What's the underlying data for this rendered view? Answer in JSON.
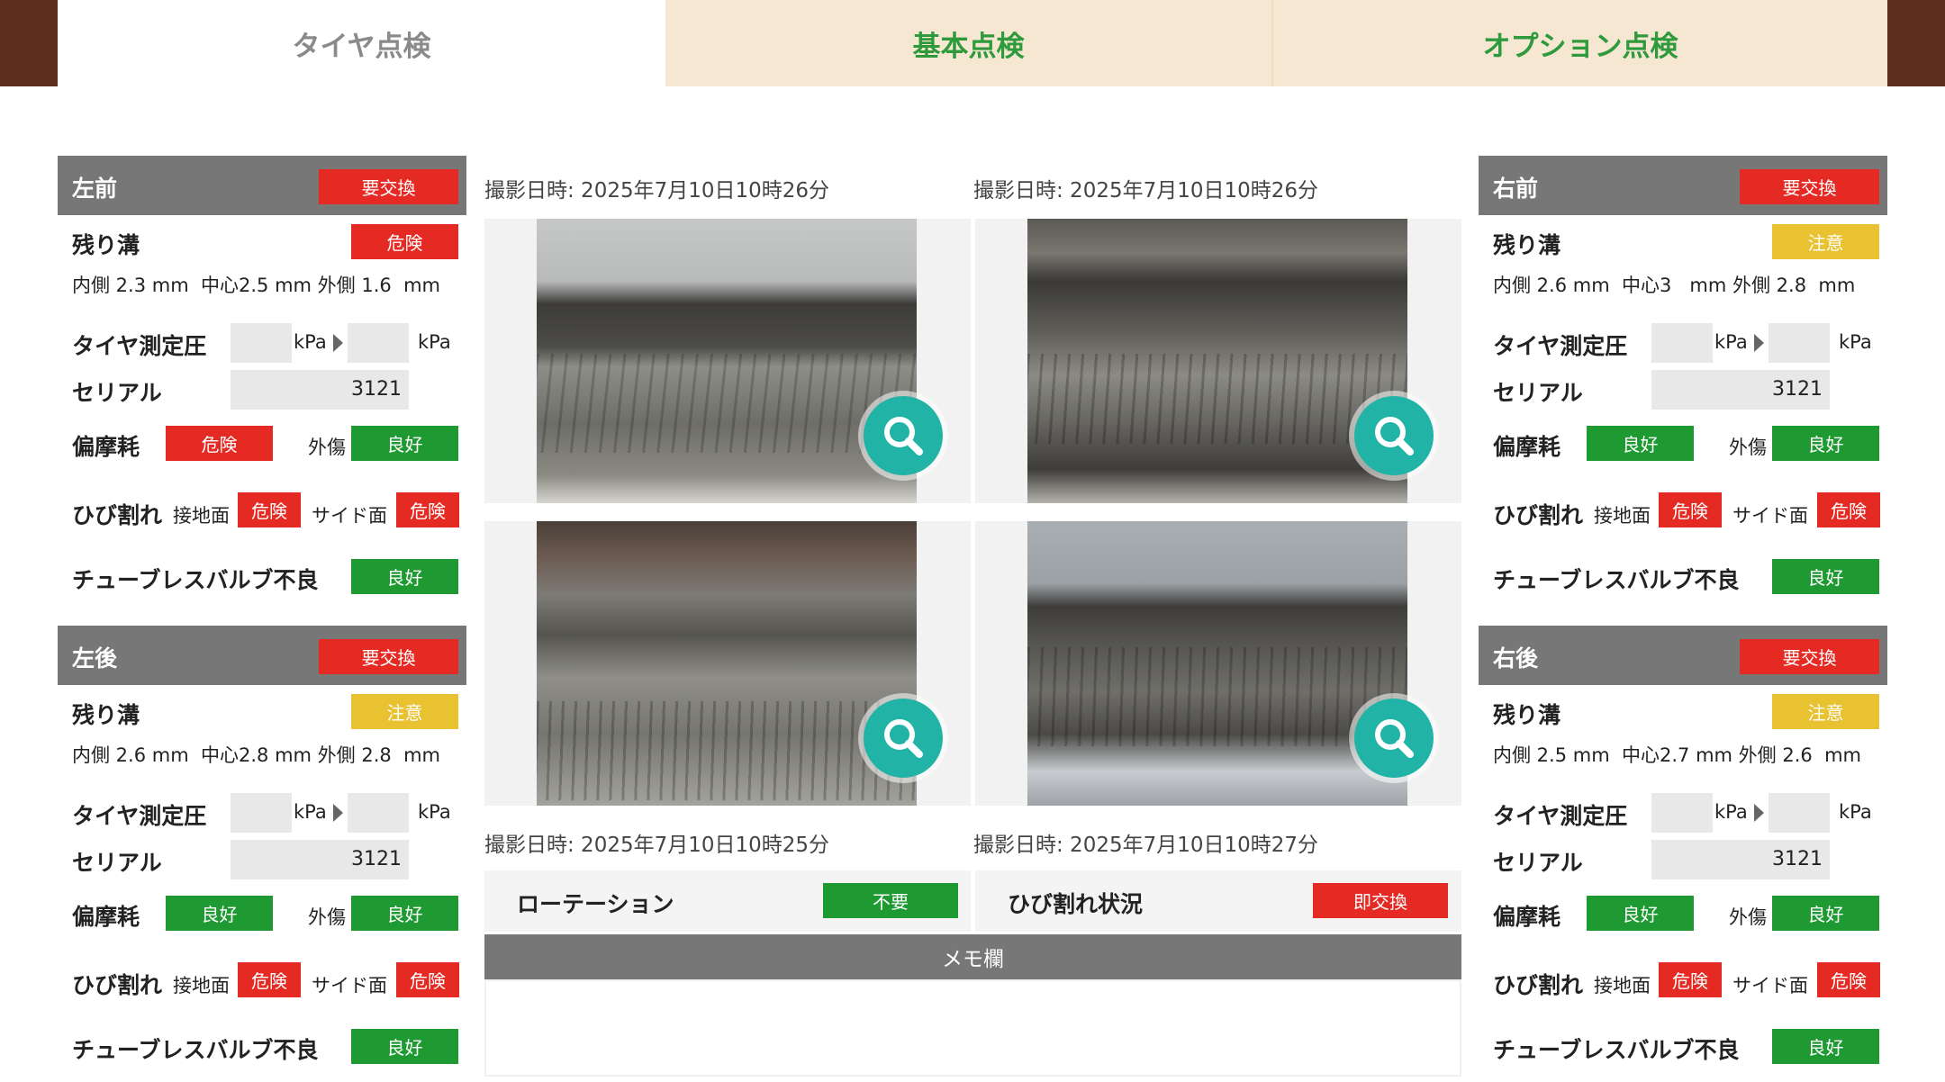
{
  "tabs": [
    "タイヤ点検",
    "基本点検",
    "オプション点検"
  ],
  "tires": [
    {
      "position": "左前",
      "status": "要交換",
      "groove_label": "残り溝",
      "groove_status": "危険",
      "groove_detail": "内側 2.3 mm  中心2.5 mm 外側 1.6  mm",
      "pressure_label": "タイヤ測定圧",
      "unit1": "kPa",
      "unit2": "kPa",
      "serial_label": "セリアル",
      "serial": "3121",
      "uneven_label": "偏摩耗",
      "uneven": "危険",
      "damage_label": "外傷",
      "damage": "良好",
      "crack_label": "ひび割れ",
      "ground_label": "接地面",
      "ground": "危険",
      "side_label": "サイド面",
      "side": "危険",
      "valve_label": "チューブレスバルブ不良",
      "valve": "良好"
    },
    {
      "position": "左後",
      "status": "要交換",
      "groove_label": "残り溝",
      "groove_status": "注意",
      "groove_detail": "内側 2.6 mm  中心2.8 mm 外側 2.8  mm",
      "pressure_label": "タイヤ測定圧",
      "unit1": "kPa",
      "unit2": "kPa",
      "serial_label": "セリアル",
      "serial": "3121",
      "uneven_label": "偏摩耗",
      "uneven": "良好",
      "damage_label": "外傷",
      "damage": "良好",
      "crack_label": "ひび割れ",
      "ground_label": "接地面",
      "ground": "危険",
      "side_label": "サイド面",
      "side": "危険",
      "valve_label": "チューブレスバルブ不良",
      "valve": "良好"
    },
    {
      "position": "右前",
      "status": "要交換",
      "groove_label": "残り溝",
      "groove_status": "注意",
      "groove_detail": "内側 2.6 mm  中心3   mm 外側 2.8  mm",
      "pressure_label": "タイヤ測定圧",
      "unit1": "kPa",
      "unit2": "kPa",
      "serial_label": "セリアル",
      "serial": "3121",
      "uneven_label": "偏摩耗",
      "uneven": "良好",
      "damage_label": "外傷",
      "damage": "良好",
      "crack_label": "ひび割れ",
      "ground_label": "接地面",
      "ground": "危険",
      "side_label": "サイド面",
      "side": "危険",
      "valve_label": "チューブレスバルブ不良",
      "valve": "良好"
    },
    {
      "position": "右後",
      "status": "要交換",
      "groove_label": "残り溝",
      "groove_status": "注意",
      "groove_detail": "内側 2.5 mm  中心2.7 mm 外側 2.6  mm",
      "pressure_label": "タイヤ測定圧",
      "unit1": "kPa",
      "unit2": "kPa",
      "serial_label": "セリアル",
      "serial": "3121",
      "uneven_label": "偏摩耗",
      "uneven": "良好",
      "damage_label": "外傷",
      "damage": "良好",
      "crack_label": "ひび割れ",
      "ground_label": "接地面",
      "ground": "危険",
      "side_label": "サイド面",
      "side": "危険",
      "valve_label": "チューブレスバルブ不良",
      "valve": "良好"
    }
  ],
  "photos": [
    {
      "stamp": "撮影日時: 2025年7月10日10時26分"
    },
    {
      "stamp": "撮影日時: 2025年7月10日10時26分"
    },
    {
      "stamp": "撮影日時: 2025年7月10日10時25分"
    },
    {
      "stamp": "撮影日時: 2025年7月10日10時27分"
    }
  ],
  "rotation": {
    "label": "ローテーション",
    "value": "不要"
  },
  "crack_status": {
    "label": "ひび割れ状況",
    "value": "即交換"
  },
  "memo": {
    "label": "メモ欄",
    "value": ""
  },
  "colors": {
    "danger": "#e52a24",
    "good": "#1f9a33",
    "caution": "#e8c230",
    "tab_active_text": "#8a8a8a",
    "tab_text": "#2f9a3c"
  }
}
